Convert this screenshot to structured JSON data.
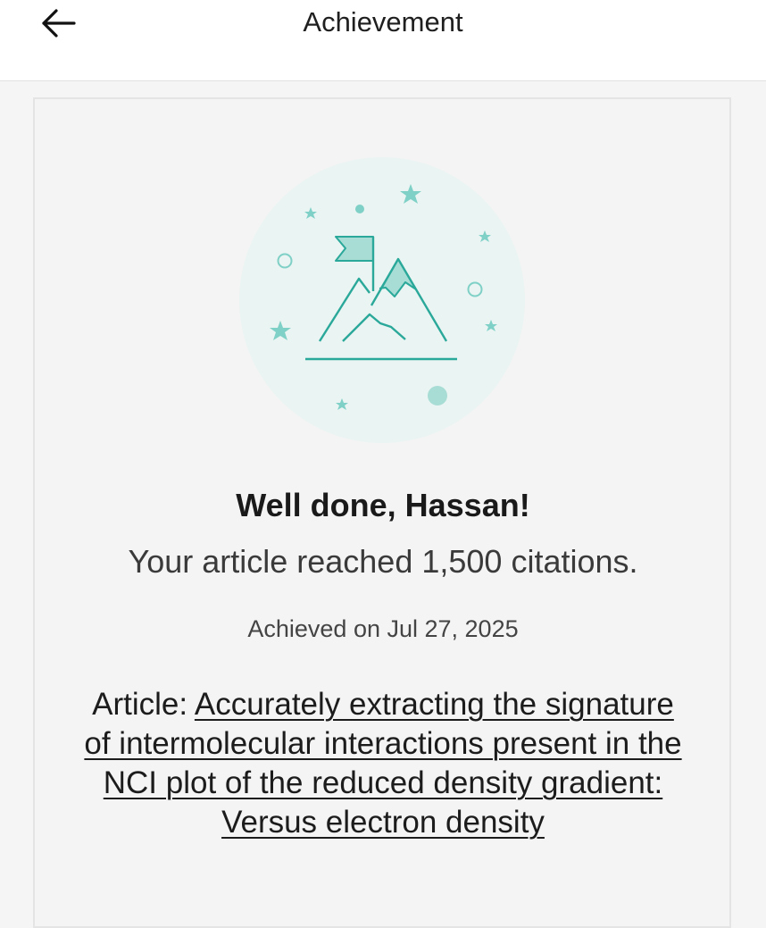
{
  "header": {
    "title": "Achievement",
    "back_icon": "arrow-left-icon"
  },
  "achievement": {
    "greeting": "Well done, Hassan!",
    "message": "Your article reached 1,500 citations.",
    "date_line": "Achieved on Jul 27, 2025",
    "article_prefix": "Article: ",
    "article_title": "Accurately extracting the signature of intermolecular interactions present in the NCI plot of the reduced density gradient: Versus electron density",
    "illustration_icon": "mountain-summit-flag-icon"
  },
  "colors": {
    "accent": "#2aa89a",
    "accent_light": "#a8ddd5",
    "circle_bg": "#eaf4f2",
    "text": "#1c1c1c"
  }
}
